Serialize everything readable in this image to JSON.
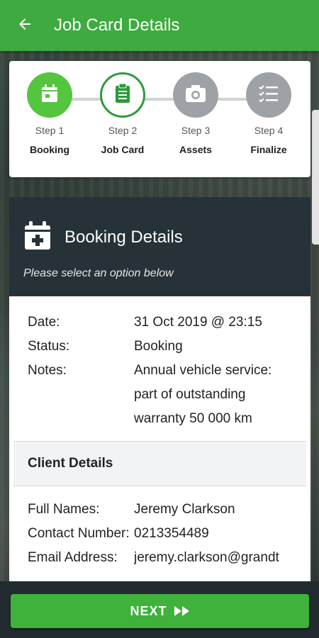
{
  "appbar": {
    "title": "Job Card Details"
  },
  "steps": [
    {
      "num": "Step 1",
      "label": "Booking",
      "state": "done",
      "icon": "calendar-icon"
    },
    {
      "num": "Step 2",
      "label": "Job Card",
      "state": "current",
      "icon": "clipboard-icon"
    },
    {
      "num": "Step 3",
      "label": "Assets",
      "state": "pending",
      "icon": "camera-icon"
    },
    {
      "num": "Step 4",
      "label": "Finalize",
      "state": "pending",
      "icon": "checklist-icon"
    }
  ],
  "booking": {
    "title": "Booking Details",
    "subtitle": "Please select an option below",
    "date_label": "Date:",
    "date_value": "31 Oct 2019 @ 23:15",
    "status_label": "Status:",
    "status_value": "Booking",
    "notes_label": "Notes:",
    "notes_value": "Annual vehicle service: part of outstanding warranty 50 000 km"
  },
  "client": {
    "title": "Client Details",
    "name_label": "Full Names:",
    "name_value": "Jeremy Clarkson",
    "contact_label": "Contact Number:",
    "contact_value": "0213354489",
    "email_label": "Email Address:",
    "email_value": "jeremy.clarkson@grandt"
  },
  "footer": {
    "next_label": "NEXT"
  },
  "colors": {
    "primary": "#3eaa3f",
    "step_done": "#53c53f",
    "step_pending": "#9ea2a6",
    "header_dark": "#263238"
  }
}
